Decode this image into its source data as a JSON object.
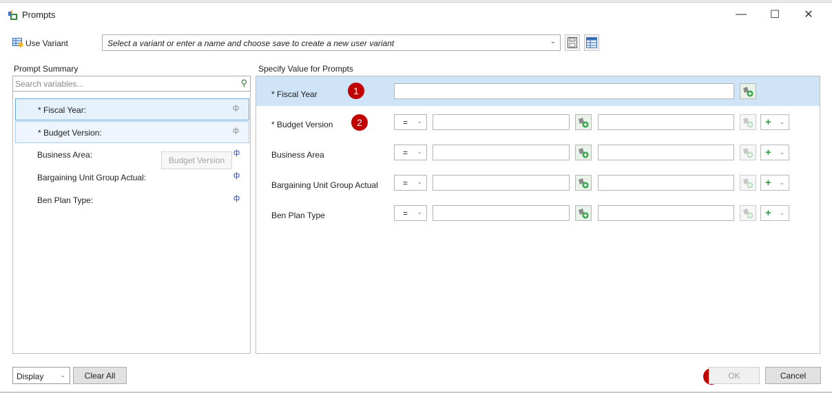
{
  "window": {
    "title": "Prompts",
    "minimize": "—",
    "maximize": "☐",
    "close": "✕"
  },
  "variant": {
    "label": "Use Variant",
    "placeholder": "Select a variant or enter a name and choose save to create a new user variant"
  },
  "summary": {
    "heading": "Prompt Summary",
    "search_placeholder": "Search variables...",
    "items": [
      {
        "label": "* Fiscal Year:"
      },
      {
        "label": "* Budget Version:"
      },
      {
        "label": "Business Area:"
      },
      {
        "label": "Bargaining Unit Group Actual:"
      },
      {
        "label": "Ben Plan Type:"
      }
    ],
    "tooltip": "Budget Version"
  },
  "prompts": {
    "heading": "Specify Value for Prompts",
    "rows": [
      {
        "label": "* Fiscal Year",
        "badge": "1"
      },
      {
        "label": "* Budget Version",
        "badge": "2",
        "operator": "="
      },
      {
        "label": "Business Area",
        "operator": "="
      },
      {
        "label": "Bargaining Unit Group Actual",
        "operator": "="
      },
      {
        "label": "Ben Plan Type",
        "operator": "="
      }
    ]
  },
  "footer": {
    "display_label": "Display",
    "clear_all": "Clear All",
    "ok_badge": "3",
    "ok": "OK",
    "cancel": "Cancel"
  },
  "colors": {
    "selected_row": "#cfe4f7",
    "badge": "#c00000",
    "pin": "#2748c6"
  }
}
